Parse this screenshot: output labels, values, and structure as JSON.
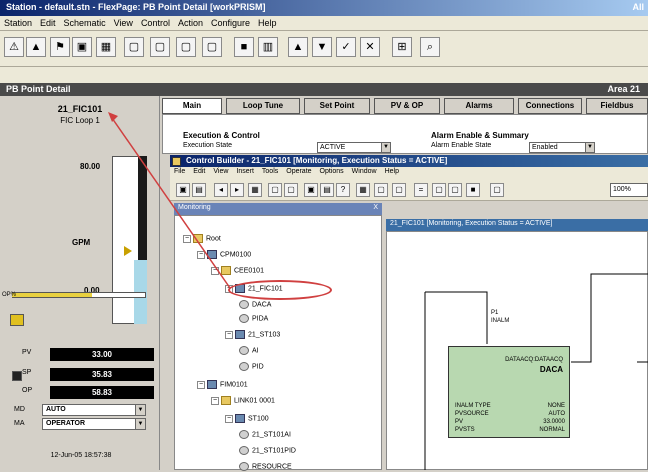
{
  "window": {
    "title": "Station - default.stn - FlexPage: PB Point Detail [workPRISM]",
    "right": "All"
  },
  "menu": [
    "Station",
    "Edit",
    "Schematic",
    "View",
    "Control",
    "Action",
    "Configure",
    "Help"
  ],
  "toolbar": {
    "icons": [
      "bell-icon",
      "alarm-icon",
      "event-icon",
      "report-icon",
      "doc-icon",
      "page1-icon",
      "page2-icon",
      "page3-icon",
      "page4-icon",
      "display-icon",
      "trend-icon",
      "up-icon",
      "down-icon",
      "check-icon",
      "x-icon",
      "tag-icon",
      "search-icon"
    ]
  },
  "faceplate_bar": {
    "title": "PB Point Detail",
    "right": "Area 21"
  },
  "point": {
    "tag": "21_FIC101",
    "desc": "FIC Loop 1",
    "scale_top": "80.00",
    "units": "GPM",
    "scale_bottom": "0.00",
    "out_label": "OP%",
    "pv_fraction": 0.38,
    "op_fraction": 0.6,
    "values": [
      {
        "label": "PV",
        "value": "33.00"
      },
      {
        "label": "SP",
        "value": "35.83"
      },
      {
        "label": "OP",
        "value": "58.83"
      }
    ],
    "mode": {
      "label": "MD",
      "value": "AUTO"
    },
    "modeattr": {
      "label": "MA",
      "value": "OPERATOR"
    },
    "footer": "12-Jun-05 18:57:38"
  },
  "tabs": [
    "Main",
    "Loop Tune",
    "Set Point",
    "PV & OP",
    "Alarms",
    "Connections",
    "Fieldbus"
  ],
  "detail": {
    "exec_title": "Execution & Control",
    "exec_state_label": "Execution State",
    "exec_state_value": "ACTIVE",
    "alarm_title": "Alarm Enable & Summary",
    "alarm_state_label": "Alarm Enable State",
    "alarm_state_value": "Enabled"
  },
  "control_builder": {
    "title": "Control Builder - 21_FIC101 [Monitoring, Execution Status = ACTIVE]",
    "menu": [
      "File",
      "Edit",
      "View",
      "Insert",
      "Tools",
      "Operate",
      "Options",
      "Window",
      "Help"
    ],
    "zoom": "100%",
    "tree_title": "Monitoring",
    "tree_close": "X",
    "sheet_title": "21_FIC101 [Monitoring, Execution Status = ACTIVE]",
    "tree": [
      {
        "label": "Root",
        "indent": 0,
        "icon": "folder"
      },
      {
        "label": "CPM0100",
        "indent": 1,
        "icon": "blk"
      },
      {
        "label": "CEE0101",
        "indent": 2,
        "icon": "folder"
      },
      {
        "label": "21_FIC101",
        "indent": 3,
        "icon": "blk"
      },
      {
        "label": "DACA",
        "indent": 4,
        "icon": "pin"
      },
      {
        "label": "PIDA",
        "indent": 4,
        "icon": "pin"
      },
      {
        "label": "21_ST103",
        "indent": 3,
        "icon": "blk"
      },
      {
        "label": "AI",
        "indent": 4,
        "icon": "pin"
      },
      {
        "label": "PID",
        "indent": 4,
        "icon": "pin"
      },
      {
        "label": "FIM0101",
        "indent": 1,
        "icon": "blk"
      },
      {
        "label": "LINK01 0001",
        "indent": 2,
        "icon": "folder"
      },
      {
        "label": "ST100",
        "indent": 3,
        "icon": "blk"
      },
      {
        "label": "21_ST101AI",
        "indent": 4,
        "icon": "pin"
      },
      {
        "label": "21_ST101PID",
        "indent": 4,
        "icon": "pin"
      },
      {
        "label": "RESOURCE",
        "indent": 4,
        "icon": "pin"
      }
    ],
    "block": {
      "title": "DATAACQ:DATAACQ",
      "name": "DACA",
      "lines": [
        "INALM TYPE",
        "PVSOURCE",
        "PV",
        "PVSTS"
      ],
      "vals": [
        "NONE",
        "AUTO",
        "33.0000",
        "NORMAL"
      ],
      "pin_in": "P1",
      "pin_in_sub": "INALM"
    }
  }
}
